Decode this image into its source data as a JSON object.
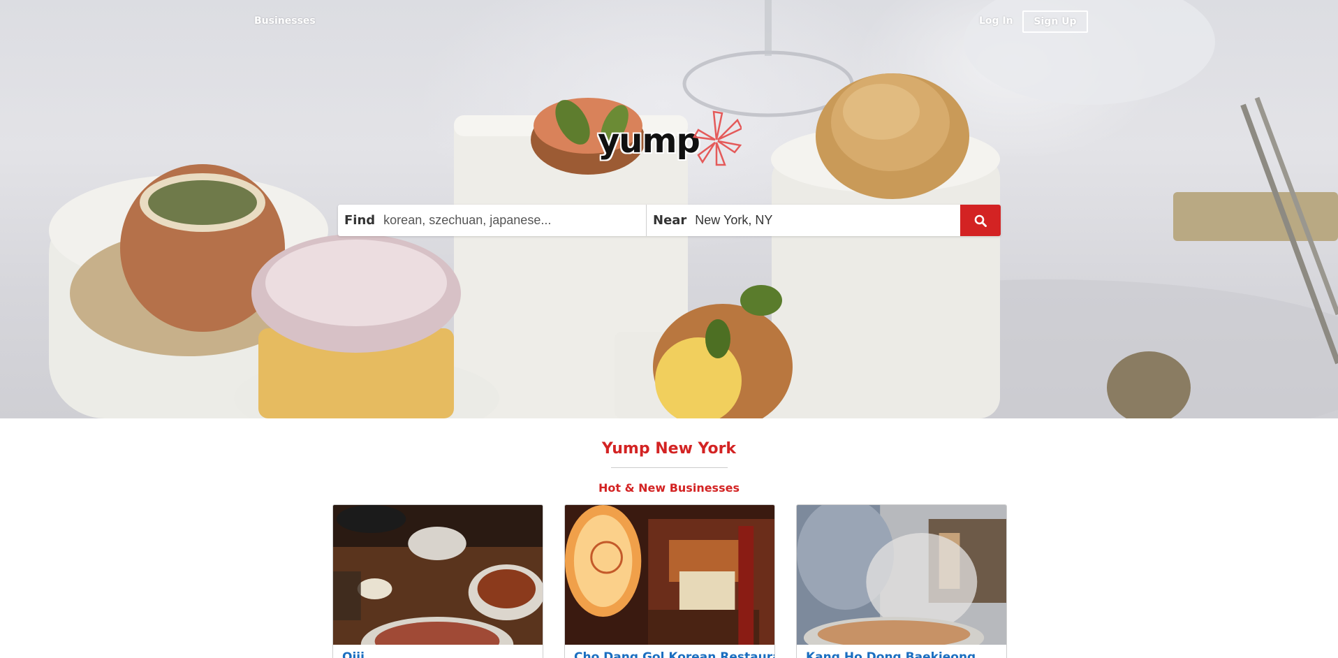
{
  "nav": {
    "businesses_label": "Businesses",
    "login_label": "Log In",
    "signup_label": "Sign Up"
  },
  "logo": {
    "text": "yump"
  },
  "search": {
    "find_label": "Find",
    "find_placeholder": "korean, szechuan, japanese...",
    "near_label": "Near",
    "near_value": "New York, NY",
    "button_icon": "search-icon"
  },
  "content": {
    "city_title": "Yump New York",
    "section_title": "Hot & New Businesses",
    "cards": [
      {
        "name": "Oiji"
      },
      {
        "name": "Cho Dang Gol Korean Restaurant"
      },
      {
        "name": "Kang Ho Dong Baekjeong"
      }
    ]
  },
  "colors": {
    "brand_red": "#d32323",
    "link_blue": "#1a6ec0"
  }
}
